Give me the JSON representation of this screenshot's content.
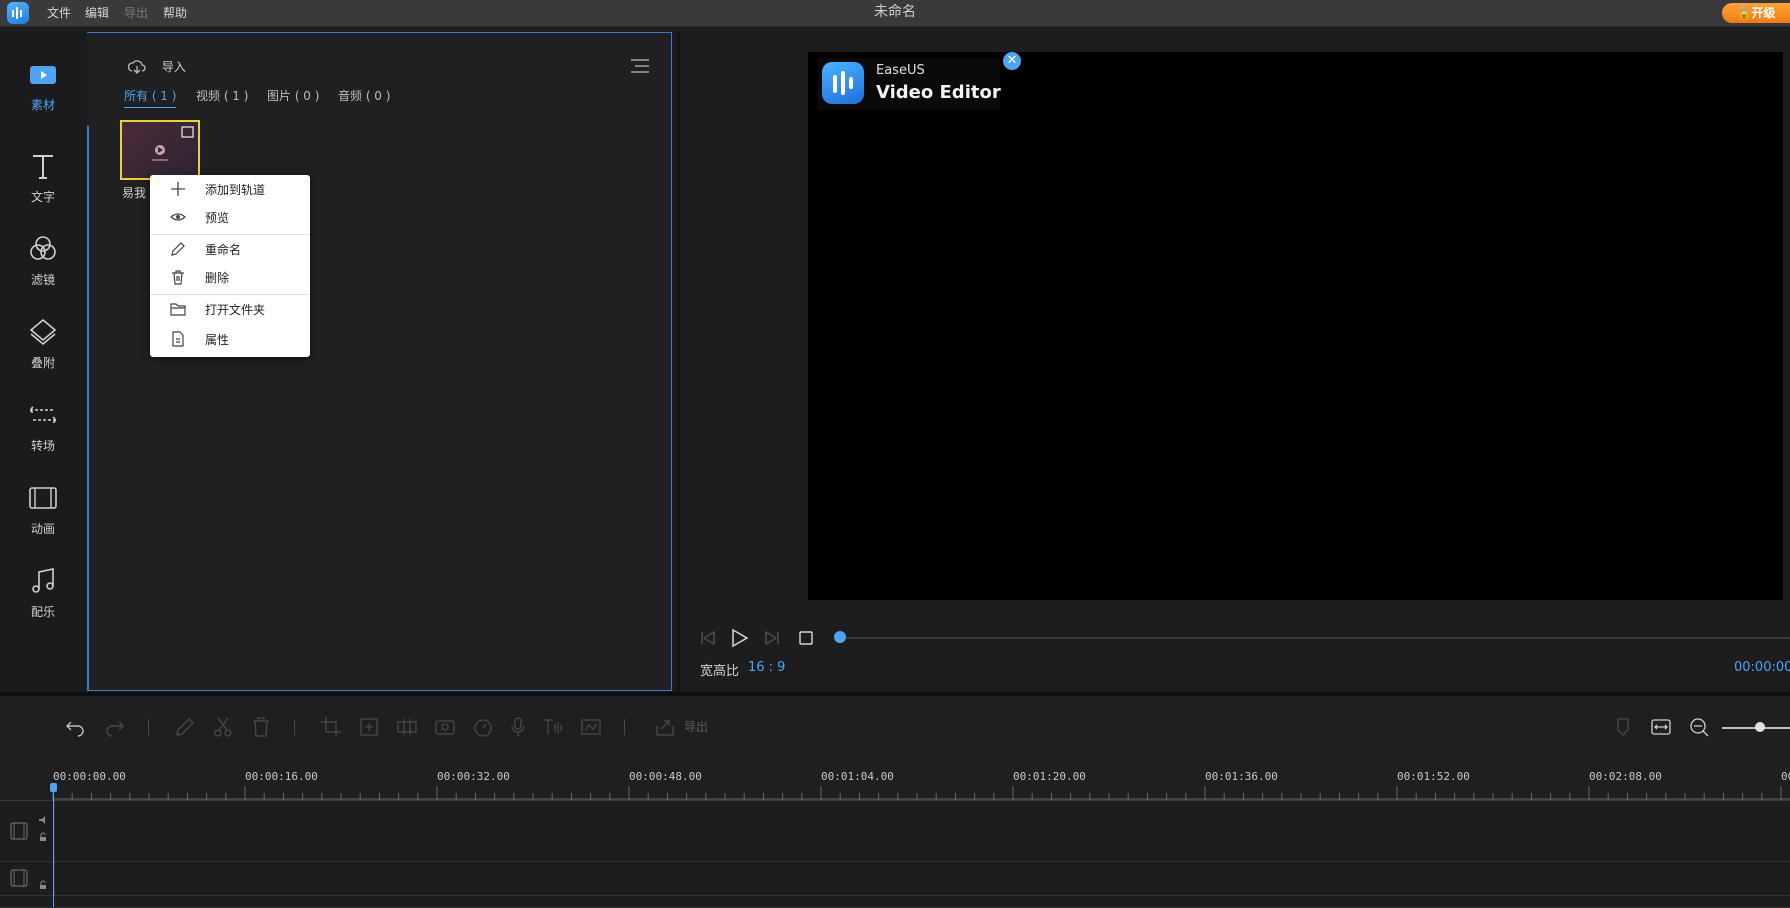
{
  "menu": {
    "items": [
      {
        "label": "文件",
        "disabled": false
      },
      {
        "label": "编辑",
        "disabled": false
      },
      {
        "label": "导出",
        "disabled": true
      },
      {
        "label": "帮助",
        "disabled": false
      }
    ]
  },
  "window": {
    "title": "未命名"
  },
  "upgrade": {
    "label": "开级"
  },
  "rail": {
    "items": [
      {
        "label": "素材",
        "icon": "media-icon",
        "active": true
      },
      {
        "label": "文字",
        "icon": "text-icon"
      },
      {
        "label": "滤镜",
        "icon": "filter-icon"
      },
      {
        "label": "叠附",
        "icon": "overlay-icon"
      },
      {
        "label": "转场",
        "icon": "transition-icon"
      },
      {
        "label": "动画",
        "icon": "animation-icon"
      },
      {
        "label": "配乐",
        "icon": "music-icon"
      }
    ]
  },
  "media": {
    "import_label": "导入",
    "tabs": [
      {
        "label": "所有 ( 1 )",
        "active": true
      },
      {
        "label": "视频 ( 1 )"
      },
      {
        "label": "图片 ( 0 )"
      },
      {
        "label": "音频 ( 0 )"
      }
    ],
    "thumb_name": "易我"
  },
  "context_menu": {
    "items": [
      {
        "label": "添加到轨道",
        "icon": "plus-icon"
      },
      {
        "label": "预览",
        "icon": "eye-icon"
      },
      {
        "label": "重命名",
        "icon": "pencil-icon"
      },
      {
        "label": "删除",
        "icon": "trash-icon"
      },
      {
        "label": "打开文件夹",
        "icon": "folder-icon"
      },
      {
        "label": "属性",
        "icon": "properties-icon"
      }
    ]
  },
  "preview": {
    "watermark_brand": "EaseUS",
    "watermark_product": "Video Editor",
    "aspect_label": "宽高比",
    "aspect_value": "16 : 9",
    "time": "00:00:00.",
    "progress": 0
  },
  "timeline": {
    "export_label": "导出",
    "zoom_level": 0.5,
    "ruler": [
      "00:00:00.00",
      "00:00:16.00",
      "00:00:32.00",
      "00:00:48.00",
      "00:01:04.00",
      "00:01:20.00",
      "00:01:36.00",
      "00:01:52.00",
      "00:02:08.00",
      "00"
    ]
  },
  "colors": {
    "accent": "#4ea4f0",
    "highlight": "#e8d23a",
    "upgrade": "#f08a1c"
  }
}
